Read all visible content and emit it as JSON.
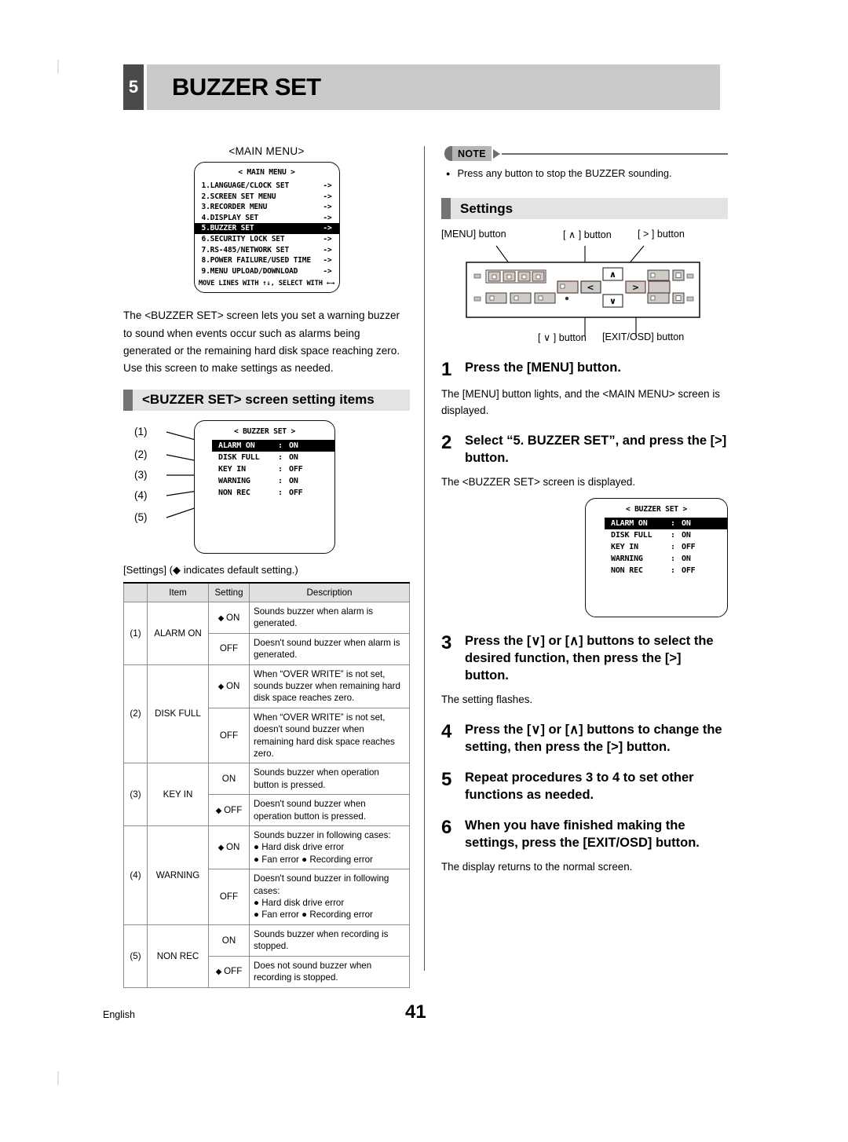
{
  "chapter": {
    "number": "5",
    "title": "BUZZER SET"
  },
  "left": {
    "main_menu_caption": "<MAIN MENU>",
    "main_menu_screen": {
      "title": "< MAIN MENU >",
      "items": [
        {
          "label": "1.LANGUAGE/CLOCK SET",
          "arrow": "->",
          "selected": false
        },
        {
          "label": "2.SCREEN SET MENU",
          "arrow": "->",
          "selected": false
        },
        {
          "label": "3.RECORDER MENU",
          "arrow": "->",
          "selected": false
        },
        {
          "label": "4.DISPLAY SET",
          "arrow": "->",
          "selected": false
        },
        {
          "label": "5.BUZZER SET",
          "arrow": "->",
          "selected": true
        },
        {
          "label": "6.SECURITY LOCK SET",
          "arrow": "->",
          "selected": false
        },
        {
          "label": "7.RS-485/NETWORK SET",
          "arrow": "->",
          "selected": false
        },
        {
          "label": "8.POWER FAILURE/USED TIME",
          "arrow": "->",
          "selected": false
        },
        {
          "label": "9.MENU UPLOAD/DOWNLOAD",
          "arrow": "->",
          "selected": false
        }
      ],
      "footer": "MOVE LINES WITH ↑↓, SELECT WITH ←→"
    },
    "intro_paragraph": "The <BUZZER SET> screen lets you set a warning buzzer to sound when events occur such as alarms being generated or the remaining hard disk space reaching zero. Use this screen to make settings as needed.",
    "section_heading": "<BUZZER SET> screen setting items",
    "callouts": [
      "(1)",
      "(2)",
      "(3)",
      "(4)",
      "(5)"
    ],
    "buzzer_screen": {
      "title": "< BUZZER SET >",
      "rows": [
        {
          "name": "ALARM ON",
          "colon": ":",
          "value": "ON",
          "selected": true
        },
        {
          "name": "DISK FULL",
          "colon": ":",
          "value": "ON",
          "selected": false
        },
        {
          "name": "KEY IN",
          "colon": ":",
          "value": "OFF",
          "selected": false
        },
        {
          "name": "WARNING",
          "colon": ":",
          "value": "ON",
          "selected": false
        },
        {
          "name": "NON REC",
          "colon": ":",
          "value": "OFF",
          "selected": false
        }
      ]
    },
    "table_caption": "[Settings] (◆ indicates default setting.)",
    "table": {
      "headers": [
        "",
        "Item",
        "Setting",
        "Description"
      ],
      "rows": [
        {
          "no": "(1)",
          "item": "ALARM ON",
          "rowspan": 2,
          "settings": [
            {
              "default": true,
              "value": "ON",
              "desc": "Sounds buzzer when alarm is generated."
            },
            {
              "default": false,
              "value": "OFF",
              "desc": "Doesn't sound buzzer when alarm is generated."
            }
          ]
        },
        {
          "no": "(2)",
          "item": "DISK FULL",
          "rowspan": 2,
          "settings": [
            {
              "default": true,
              "value": "ON",
              "desc": "When “OVER WRITE” is not set, sounds buzzer when remaining hard disk space reaches zero."
            },
            {
              "default": false,
              "value": "OFF",
              "desc": "When “OVER WRITE” is not set, doesn't sound buzzer when remaining hard disk space reaches zero."
            }
          ]
        },
        {
          "no": "(3)",
          "item": "KEY IN",
          "rowspan": 2,
          "settings": [
            {
              "default": false,
              "value": "ON",
              "desc": "Sounds buzzer when operation button is pressed."
            },
            {
              "default": true,
              "value": "OFF",
              "desc": "Doesn't sound buzzer when operation button is pressed."
            }
          ]
        },
        {
          "no": "(4)",
          "item": "WARNING",
          "rowspan": 2,
          "settings": [
            {
              "default": true,
              "value": "ON",
              "desc": "Sounds buzzer in following cases:\n● Hard disk drive error\n● Fan error ● Recording error"
            },
            {
              "default": false,
              "value": "OFF",
              "desc": "Doesn't sound buzzer in following cases:\n● Hard disk drive error\n● Fan error ● Recording error"
            }
          ]
        },
        {
          "no": "(5)",
          "item": "NON REC",
          "rowspan": 2,
          "settings": [
            {
              "default": false,
              "value": "ON",
              "desc": "Sounds buzzer when recording is stopped."
            },
            {
              "default": true,
              "value": "OFF",
              "desc": "Does not sound buzzer when recording is stopped."
            }
          ]
        }
      ]
    }
  },
  "right": {
    "note": {
      "label": "NOTE",
      "bullet": "●",
      "text": "Press any button to stop the BUZZER sounding."
    },
    "section_heading": "Settings",
    "panel": {
      "labels_top": [
        "[MENU] button",
        "[ ∧ ] button",
        "[ > ] button"
      ],
      "labels_bottom": [
        "[ ∨ ] button",
        "[EXIT/OSD] button"
      ],
      "glyph_up": "∧",
      "glyph_down": "∨",
      "glyph_left": "<",
      "glyph_right": ">"
    },
    "steps": [
      {
        "n": "1",
        "title": "Press the [MENU] button.",
        "sub": "The [MENU] button lights, and the <MAIN MENU> screen is displayed."
      },
      {
        "n": "2",
        "title": "Select “5. BUZZER SET”, and press the [>] button.",
        "sub": "The <BUZZER SET> screen is displayed."
      },
      {
        "n": "3",
        "title": "Press the [∨] or [∧] buttons to select the desired function, then press the [>] button.",
        "sub": "The setting flashes."
      },
      {
        "n": "4",
        "title": "Press the [∨] or [∧] buttons to change the setting, then press the [>] button.",
        "sub": ""
      },
      {
        "n": "5",
        "title": "Repeat procedures 3 to 4 to set other functions as needed.",
        "sub": ""
      },
      {
        "n": "6",
        "title": "When you have finished making the settings, press the [EXIT/OSD] button.",
        "sub": "The display returns to the normal screen."
      }
    ],
    "buzzer_screen": {
      "title": "< BUZZER SET >",
      "rows": [
        {
          "name": "ALARM ON",
          "colon": ":",
          "value": "ON",
          "selected": true
        },
        {
          "name": "DISK FULL",
          "colon": ":",
          "value": "ON",
          "selected": false
        },
        {
          "name": "KEY IN",
          "colon": ":",
          "value": "OFF",
          "selected": false
        },
        {
          "name": "WARNING",
          "colon": ":",
          "value": "ON",
          "selected": false
        },
        {
          "name": "NON REC",
          "colon": ":",
          "value": "OFF",
          "selected": false
        }
      ]
    }
  },
  "footer": {
    "language": "English",
    "page": "41"
  }
}
